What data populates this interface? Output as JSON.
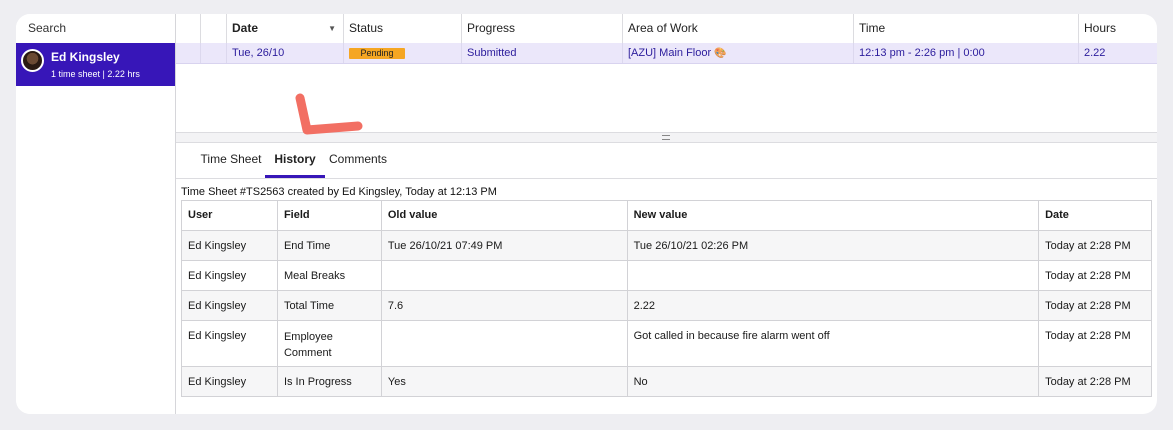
{
  "sidebar": {
    "search_label": "Search",
    "employee": {
      "name": "Ed Kingsley",
      "summary": "1 time sheet | 2.22 hrs"
    }
  },
  "grid": {
    "columns": [
      "Date",
      "Status",
      "Progress",
      "Area of Work",
      "Time",
      "Hours"
    ],
    "row": {
      "date": "Tue, 26/10",
      "status": "Pending",
      "progress": "Submitted",
      "area": "[AZU] Main Floor",
      "area_icon": "🎨",
      "time": "12:13 pm - 2:26 pm | 0:00",
      "hours": "2.22"
    }
  },
  "tabs": {
    "items": [
      "Time Sheet",
      "History",
      "Comments"
    ],
    "active": "History"
  },
  "history": {
    "created_line": "Time Sheet #TS2563  created by Ed Kingsley, Today at 12:13 PM",
    "headers": [
      "User",
      "Field",
      "Old value",
      "New value",
      "Date"
    ],
    "rows": [
      [
        "Ed Kingsley",
        "End Time",
        "Tue 26/10/21 07:49 PM",
        "Tue 26/10/21 02:26 PM",
        "Today at 2:28 PM"
      ],
      [
        "Ed Kingsley",
        "Meal Breaks",
        "",
        "",
        "Today at 2:28 PM"
      ],
      [
        "Ed Kingsley",
        "Total Time",
        "7.6",
        "2.22",
        "Today at 2:28 PM"
      ],
      [
        "Ed Kingsley",
        "Employee Comment",
        "",
        "Got called in because fire alarm went off",
        "Today at 2:28 PM"
      ],
      [
        "Ed Kingsley",
        "Is In Progress",
        "Yes",
        "No",
        "Today at 2:28 PM"
      ]
    ]
  },
  "colors": {
    "accent": "#3716b8",
    "pending": "#f5a623",
    "annotation": "#f26f63"
  }
}
